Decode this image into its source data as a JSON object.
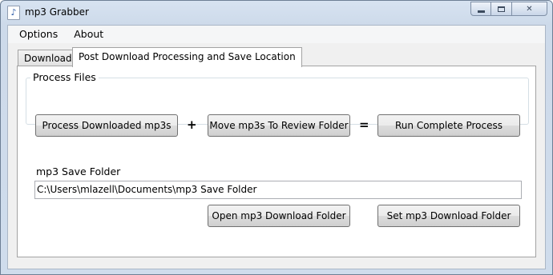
{
  "window": {
    "title": "mp3 Grabber",
    "icon": "music-note-icon"
  },
  "menu": {
    "items": [
      "Options",
      "About"
    ]
  },
  "tabs": {
    "download_label": "Download",
    "post_processing_label": "Post Download Processing and Save Location",
    "active": "post_processing"
  },
  "process_files": {
    "group_label": "Process Files",
    "process_button": "Process Downloaded mp3s",
    "plus_symbol": "+",
    "move_button": "Move mp3s To Review Folder",
    "equals_symbol": "=",
    "run_button": "Run Complete Process"
  },
  "save_folder": {
    "label": "mp3 Save Folder",
    "path_value": "C:\\Users\\mlazell\\Documents\\mp3 Save Folder",
    "open_button": "Open mp3 Download Folder",
    "set_button": "Set mp3 Download Folder"
  }
}
